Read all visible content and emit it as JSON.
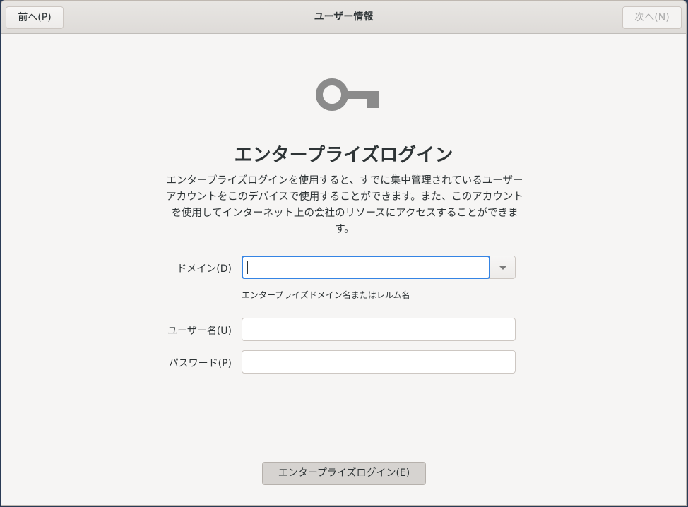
{
  "header": {
    "title": "ユーザー情報",
    "prev_label": "前へ(P)",
    "next_label": "次へ(N)"
  },
  "main": {
    "icon": "key-icon",
    "heading": "エンタープライズログイン",
    "description": "エンタープライズログインを使用すると、すでに集中管理されているユーザーアカウントをこのデバイスで使用することができます。また、このアカウントを使用してインターネット上の会社のリソースにアクセスすることができます。"
  },
  "form": {
    "domain_label": "ドメイン(D)",
    "domain_value": "",
    "domain_hint": "エンタープライズドメイン名またはレルム名",
    "username_label": "ユーザー名(U)",
    "username_value": "",
    "password_label": "パスワード(P)",
    "password_value": ""
  },
  "actions": {
    "login_label": "エンタープライズログイン(E)"
  },
  "colors": {
    "accent": "#3584e4",
    "background": "#f6f5f4",
    "text": "#2e3436"
  }
}
